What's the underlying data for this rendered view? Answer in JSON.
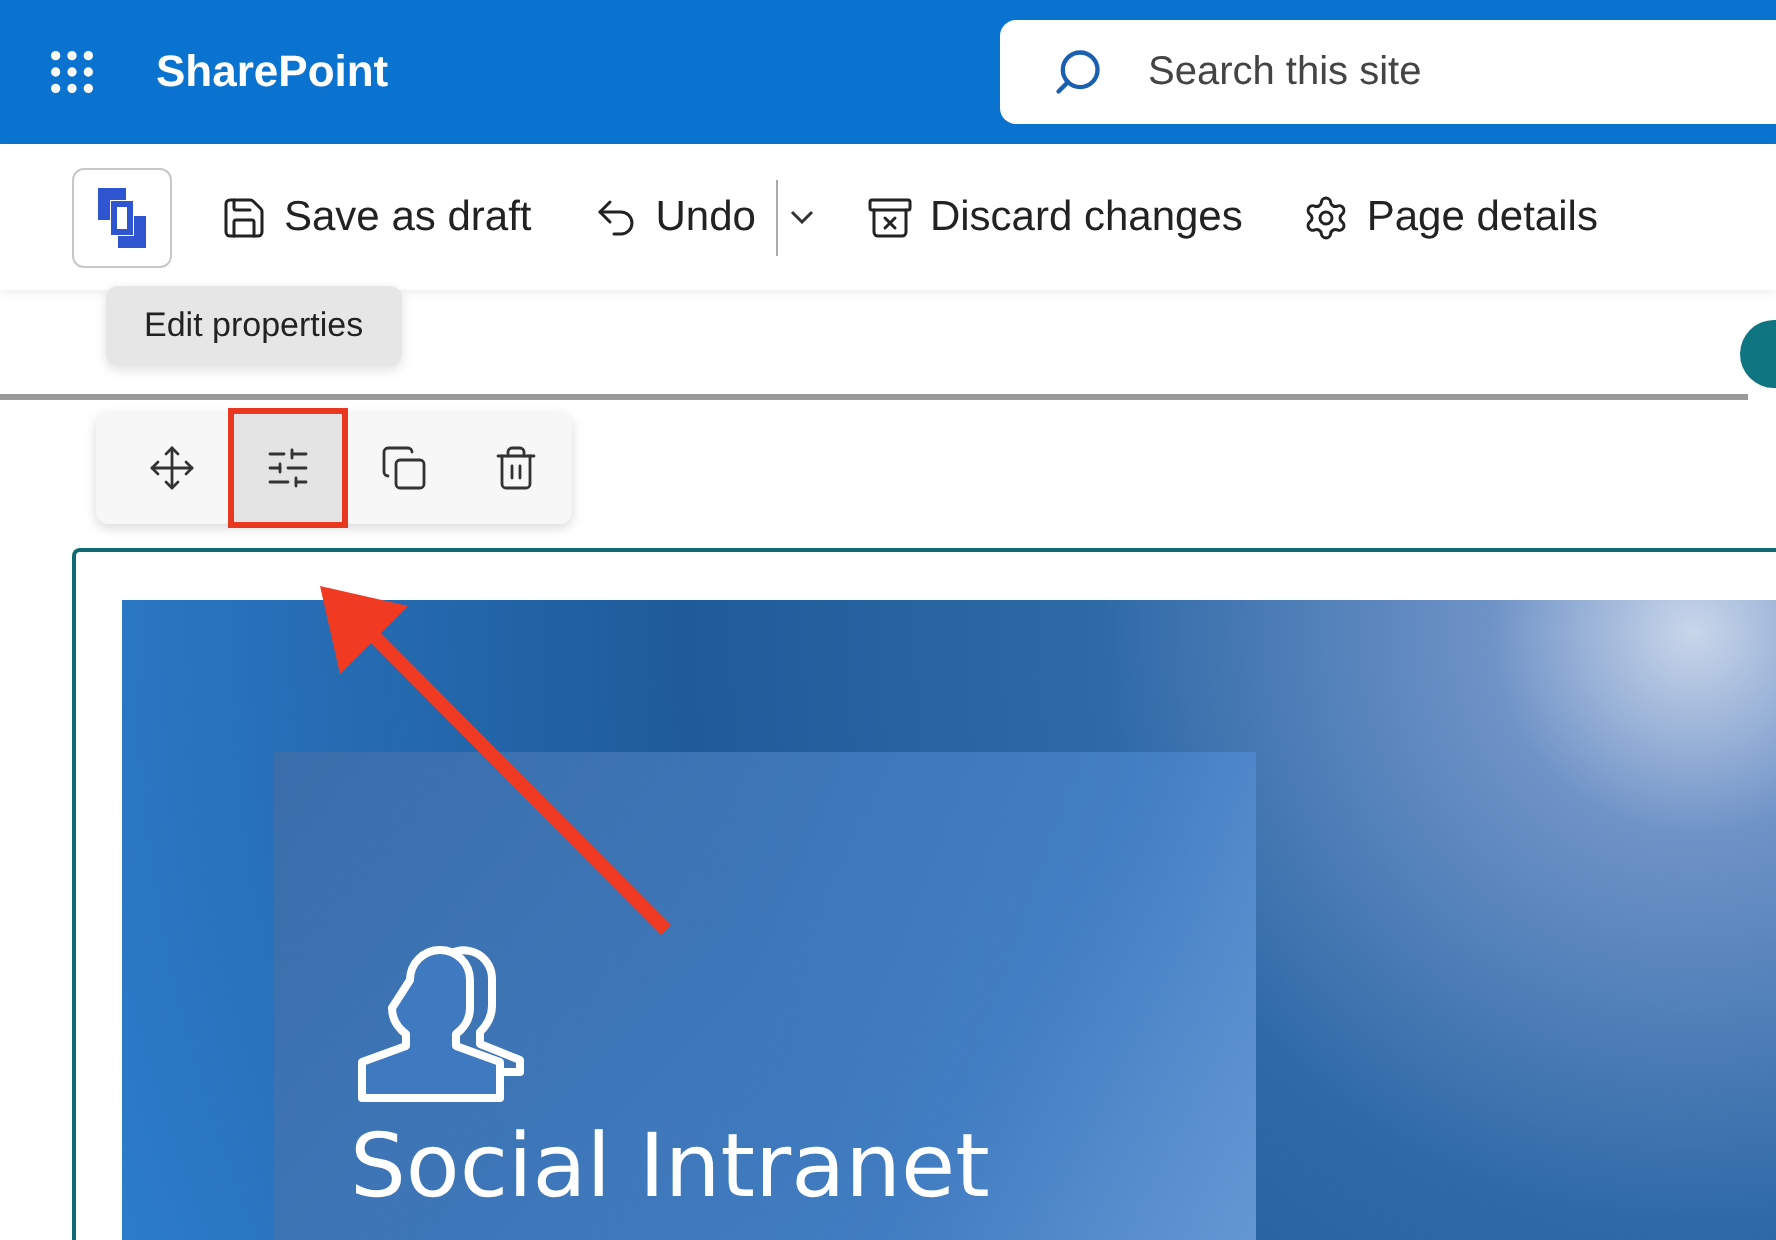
{
  "header": {
    "title": "SharePoint",
    "search": {
      "placeholder": "Search this site"
    }
  },
  "command_bar": [
    {
      "kind": "save",
      "label": "Save as draft"
    },
    {
      "kind": "undo",
      "label": "Undo"
    },
    {
      "kind": "dropdown"
    },
    {
      "kind": "discard",
      "label": "Discard changes"
    },
    {
      "kind": "details",
      "label": "Page details"
    }
  ],
  "tooltip": "Edit properties",
  "webpart_toolbar": [
    {
      "kind": "move",
      "selected": false
    },
    {
      "kind": "edit",
      "selected": true
    },
    {
      "kind": "duplicate",
      "selected": false
    },
    {
      "kind": "delete",
      "selected": false
    }
  ],
  "hero": {
    "title": "Social Intranet"
  }
}
